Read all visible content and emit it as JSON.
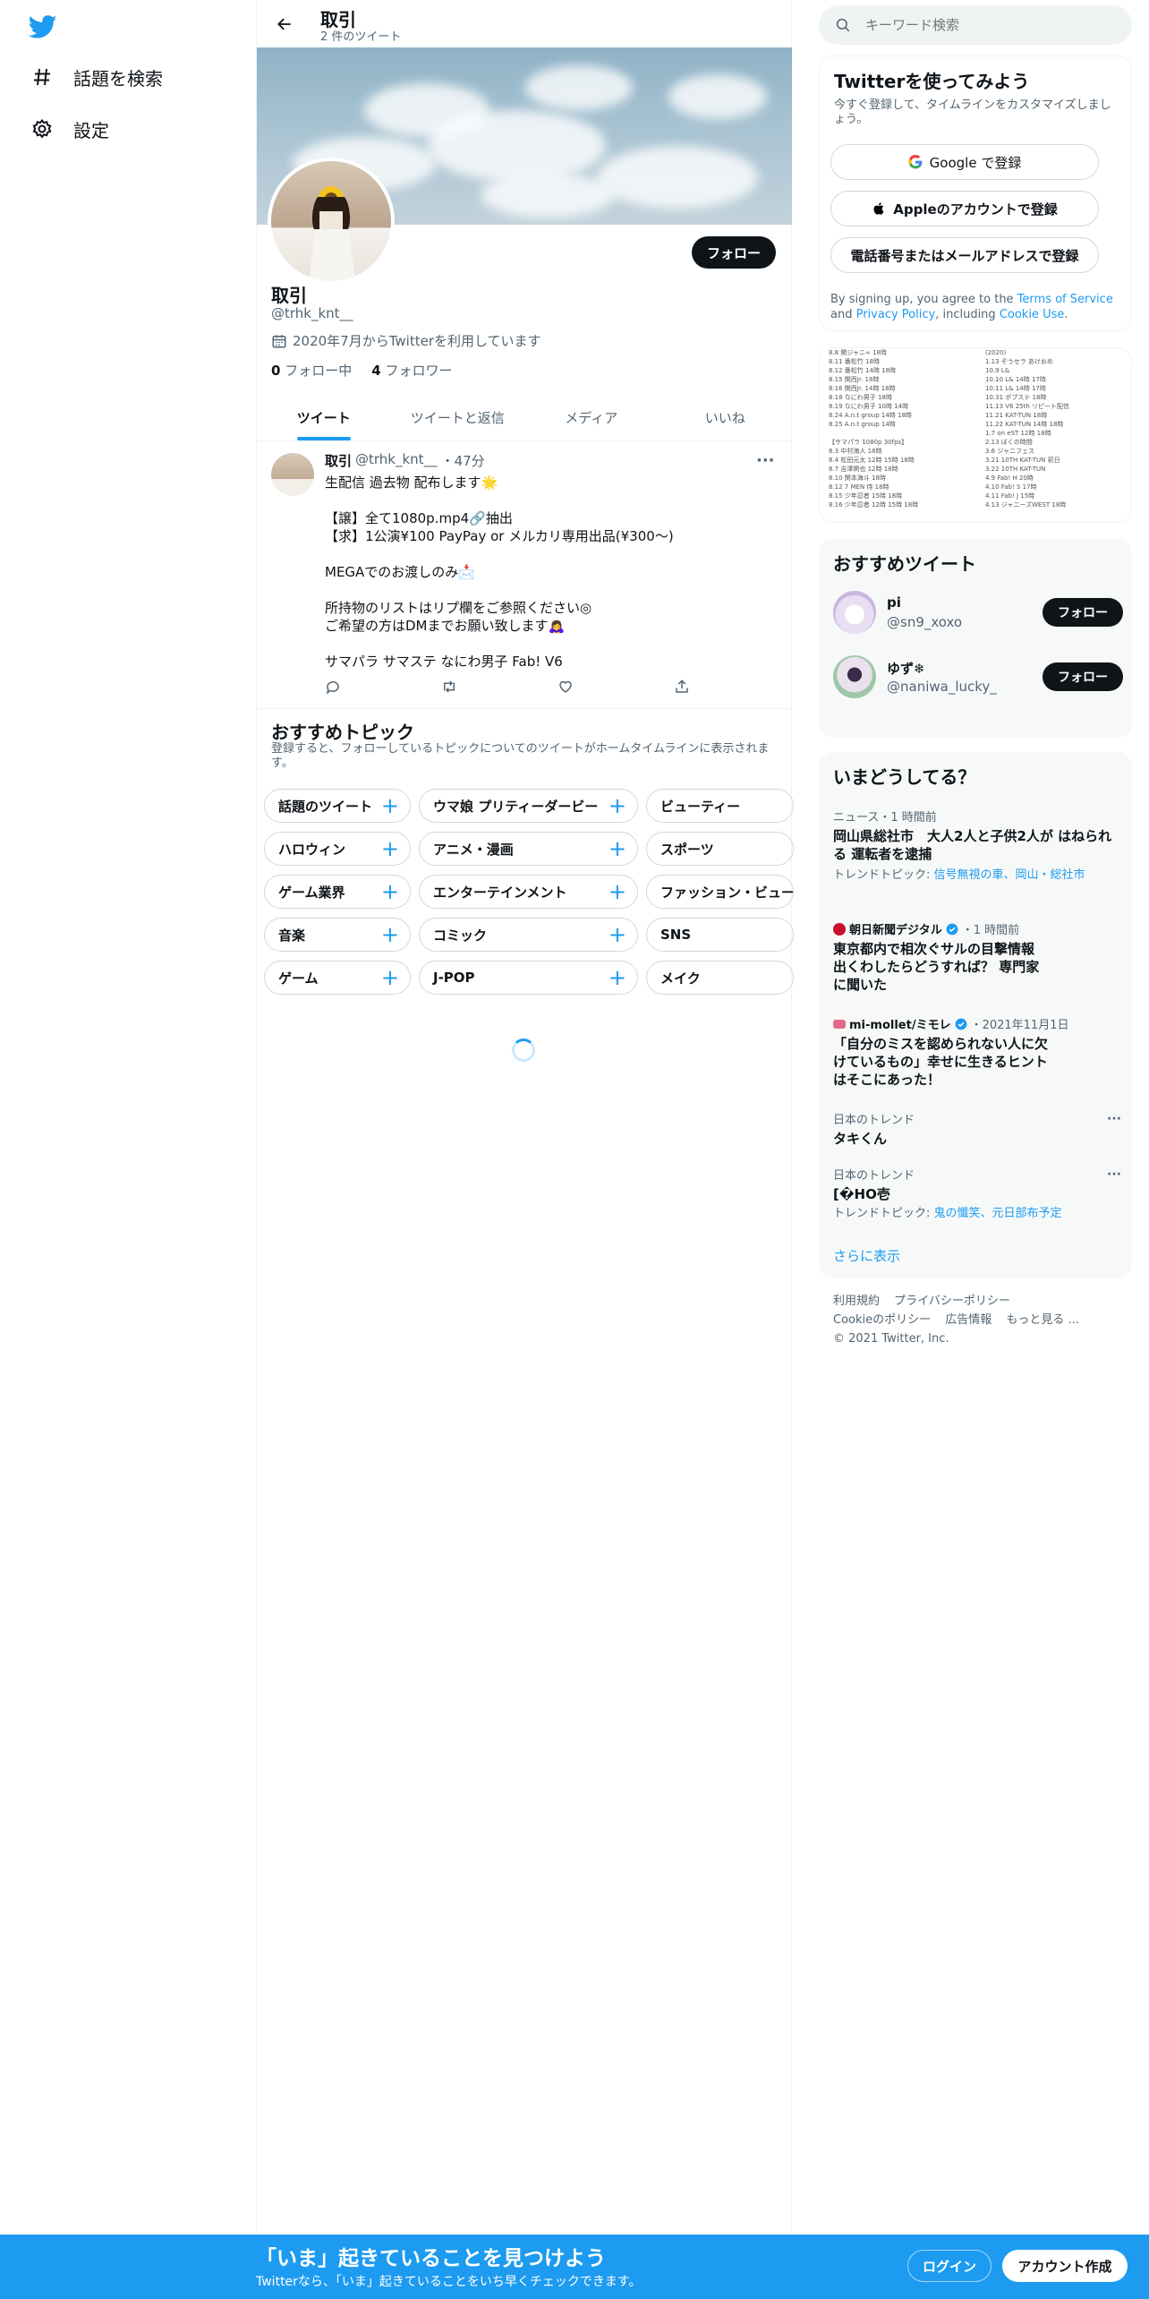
{
  "nav": {
    "items": [
      {
        "label": "話題を検索",
        "icon": "hashtag-icon"
      },
      {
        "label": "設定",
        "icon": "gear-icon"
      }
    ]
  },
  "profile_header": {
    "title": "取引",
    "tweet_count": "2 件のツイート"
  },
  "profile": {
    "name": "取引",
    "handle": "@trhk_knt__",
    "joined": "2020年7月からTwitterを利用しています",
    "following_count": "0",
    "following_label": "フォロー中",
    "followers_count": "4",
    "followers_label": "フォロワー",
    "follow_label": "フォロー"
  },
  "tabs": [
    "ツイート",
    "ツイートと返信",
    "メディア",
    "いいね"
  ],
  "tweet": {
    "name": "取引",
    "handle": "@trhk_knt__",
    "time": "・47分",
    "more": "···",
    "lines": [
      "生配信 過去物 配布します🌟",
      "",
      "【譲】全て1080p.mp4🔗抽出",
      "【求】1公演¥100 PayPay or メルカリ専用出品(¥300〜)",
      "",
      "MEGAでのお渡しのみ📩",
      "",
      "所持物のリストはリプ欄をご参照ください◎",
      "ご希望の方はDMまでお願い致します🙇‍♀️",
      "",
      "サマパラ サマステ なにわ男子 Fab! V6"
    ]
  },
  "topics": {
    "title": "おすすめトピック",
    "description": "登録すると、フォローしているトピックについてのツイートがホームタイムラインに表示されます。",
    "rows": [
      [
        "話題のツイート",
        "ウマ娘 プリティーダービー",
        "ビューティー"
      ],
      [
        "ハロウィン",
        "アニメ・漫画",
        "スポーツ"
      ],
      [
        "ゲーム業界",
        "エンターテインメント",
        "ファッション・ビュー"
      ],
      [
        "音楽",
        "コミック",
        "SNS"
      ],
      [
        "ゲーム",
        "J-POP",
        "メイク"
      ]
    ],
    "plus": "+"
  },
  "search": {
    "placeholder": "キーワード検索"
  },
  "signup_card": {
    "title": "Twitterを使ってみよう",
    "subtitle": "今すぐ登録して、タイムラインをカスタマイズしましょう。",
    "google": "Google で登録",
    "apple": "Appleのアカウントで登録",
    "phone": "電話番号またはメールアドレスで登録",
    "terms_prefix": "By signing up, you agree to the ",
    "terms_link": "Terms of Service",
    "terms_and": " and ",
    "privacy_link": "Privacy Policy",
    "terms_including": ", including ",
    "cookie_link": "Cookie Use",
    "terms_end": "."
  },
  "list_image": {
    "left": [
      "8.8 関ジャニ∞ 18時",
      "8.11 番松竹 18時",
      "8.12 番松竹 14時 18時",
      "8.15 関西Jr. 18時",
      "8.16 関西Jr. 14時 18時",
      "8.18 なにわ男子 18時",
      "8.19 なにわ男子 10時 14時",
      "8.24 A.n.t group 14時 18時",
      "8.25 A.n.t group 14時",
      "",
      "【サマパラ 1080p 30fps】",
      "8.3 中村海人 18時",
      "8.4 松田元太 12時 15時 18時",
      "8.7 吉澤閑也 12時 18時",
      "8.10 関本海斗 18時",
      "8.12 7 MEN 侍 18時",
      "8.15 少年忍者 15時 18時",
      "8.16 少年忍者 12時 15時 18時"
    ],
    "right": [
      "(2020)",
      "1.13 ぞうセラ あけおめ",
      "10.9 L&",
      "10.10 L& 14時 17時",
      "10.11 L& 14時 17時",
      "10.31 ポプステ 18時",
      "11.13 V6 25th リピート配信",
      "11.21 KAT-TUN 18時",
      "11.22 KAT-TUN 14時 18時",
      "1.7 on eST 12時 18時",
      "2.13 ぼくの時間",
      "3.6 ジャニフェス",
      "3.21 10TH KAT-TUN 初日",
      "3.22 10TH KAT-TUN",
      "4.9 Fab! H 20時",
      "4.10 Fab! S 17時",
      "4.11 Fab! J 15時",
      "4.13 ジャニーズWEST 18時"
    ]
  },
  "who_to_follow": {
    "title": "おすすめツイート",
    "users": [
      {
        "name": "pi",
        "handle": "@sn9_xoxo",
        "follow": "フォロー"
      },
      {
        "name": "ゆず❄",
        "handle": "@naniwa_lucky_",
        "follow": "フォロー"
      }
    ]
  },
  "trends": {
    "title": "いまどうしてる？",
    "items": [
      {
        "meta": "ニュース・1 時間前",
        "title": "岡山県総社市　大人2人と子供2人が はねられる 運転者を逮捕",
        "topic_prefix": "トレンドトピック: ",
        "topic": "信号無視の車、岡山・総社市"
      },
      {
        "meta_source": "朝日新聞デジタル",
        "meta_time": "・1 時間前",
        "title": "東京都内で相次ぐサルの目撃情報 出くわしたらどうすれば？ 専門家に聞いた"
      },
      {
        "meta_source": "mi-mollet/ミモレ",
        "meta_time": "・2021年11月1日",
        "title": "「自分のミスを認められない人に欠けているもの」幸せに生きるヒントはそこにあった！"
      },
      {
        "meta": "日本のトレンド",
        "title": "タキくん",
        "more": "···"
      },
      {
        "meta": "日本のトレンド",
        "title": "[�HO壱",
        "topic_prefix": "トレンドトピック: ",
        "topic": "鬼の懺笑、元日部布予定",
        "more": "···"
      }
    ],
    "show_more": "さらに表示"
  },
  "footer": {
    "links1": [
      "利用規約",
      "プライバシーポリシー"
    ],
    "links2": [
      "Cookieのポリシー",
      "広告情報",
      "もっと見る ..."
    ],
    "copyright": "© 2021 Twitter, Inc."
  },
  "bottom_bar": {
    "title": "「いま」起きていることを見つけよう",
    "subtitle": "Twitterなら、「いま」起きていることをいち早くチェックできます。",
    "login": "ログイン",
    "signup": "アカウント作成"
  },
  "colors": {
    "accent": "#1d9bf0",
    "text": "#0f1419",
    "muted": "#536471",
    "border": "#eff3f4"
  }
}
